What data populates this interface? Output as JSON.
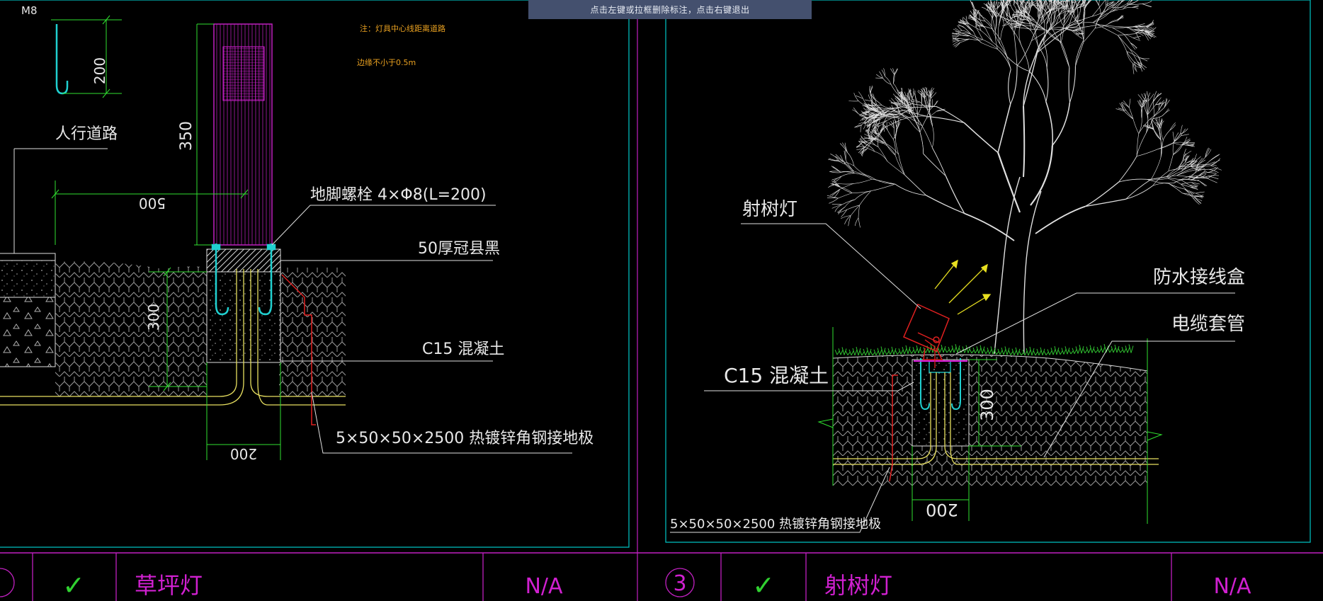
{
  "banner": {
    "text": "点击左键或拉框删除标注，点击右键退出"
  },
  "left_detail": {
    "hook_label": "M8",
    "dim_hook": "200",
    "dim_column": "350",
    "dim_width": "500",
    "dim_foundation_depth": "300",
    "dim_foundation_width": "200",
    "label_sidewalk": "人行道路",
    "label_bolts": "地脚螺栓 4×Φ8(L=200)",
    "label_stone": "50厚冠县黑",
    "label_concrete": "C15 混凝土",
    "label_ground": "5×50×50×2500 热镀锌角钢接地极",
    "note_line1": "注：灯具中心线距离道路",
    "note_line2": "边缘不小于0.5m"
  },
  "right_detail": {
    "label_uplight": "射树灯",
    "label_box": "防水接线盒",
    "label_conduit": "电缆套管",
    "label_concrete": "C15 混凝土",
    "dim_depth": "300",
    "dim_width": "200",
    "label_ground": "5×50×50×2500 热镀锌角钢接地极"
  },
  "title_bar": {
    "left": {
      "check": "✓",
      "name": "草坪灯",
      "scale": "N/A"
    },
    "right": {
      "number": "3",
      "check": "✓",
      "name": "射树灯",
      "scale": "N/A"
    }
  },
  "colors": {
    "background": "#000000",
    "frame_cyan": "#00c8c8",
    "dim_green": "#30e030",
    "lamp_magenta": "#c020c0",
    "pipe_yellow": "#e8e060",
    "ground_red": "#e02020",
    "bolt_cyan": "#20e0e0"
  }
}
